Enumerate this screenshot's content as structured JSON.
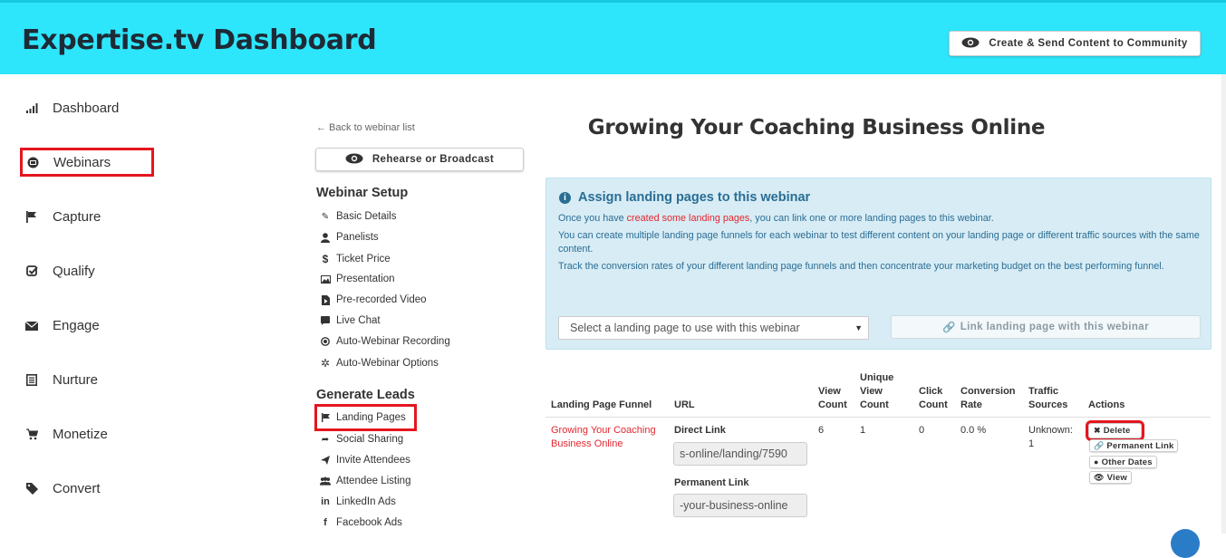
{
  "header": {
    "app_title": "Expertise.tv Dashboard",
    "create_button": "Create & Send Content to Community"
  },
  "sidebar": {
    "items": [
      {
        "label": "Dashboard",
        "icon": "bar-chart-icon"
      },
      {
        "label": "Webinars",
        "icon": "webinar-icon"
      },
      {
        "label": "Capture",
        "icon": "flag-icon"
      },
      {
        "label": "Qualify",
        "icon": "check-square-icon"
      },
      {
        "label": "Engage",
        "icon": "envelope-icon"
      },
      {
        "label": "Nurture",
        "icon": "list-icon"
      },
      {
        "label": "Monetize",
        "icon": "cart-icon"
      },
      {
        "label": "Convert",
        "icon": "tag-icon"
      }
    ]
  },
  "webinar_nav": {
    "back_link": "← Back to webinar list",
    "rehearse_button": "Rehearse or Broadcast",
    "setup_title": "Webinar Setup",
    "setup_items": [
      {
        "label": "Basic Details",
        "icon": "pencil-icon"
      },
      {
        "label": "Panelists",
        "icon": "user-icon"
      },
      {
        "label": "Ticket Price",
        "icon": "dollar-icon"
      },
      {
        "label": "Presentation",
        "icon": "image-icon"
      },
      {
        "label": "Pre-recorded Video",
        "icon": "video-file-icon"
      },
      {
        "label": "Live Chat",
        "icon": "chat-icon"
      },
      {
        "label": "Auto-Webinar Recording",
        "icon": "record-icon"
      },
      {
        "label": "Auto-Webinar Options",
        "icon": "cog-icon"
      }
    ],
    "leads_title": "Generate Leads",
    "leads_items": [
      {
        "label": "Landing Pages",
        "icon": "flag-icon"
      },
      {
        "label": "Social Sharing",
        "icon": "share-icon"
      },
      {
        "label": "Invite Attendees",
        "icon": "send-icon"
      },
      {
        "label": "Attendee Listing",
        "icon": "users-icon"
      },
      {
        "label": "LinkedIn Ads",
        "icon": "linkedin-icon"
      },
      {
        "label": "Facebook Ads",
        "icon": "facebook-icon"
      }
    ]
  },
  "main": {
    "page_title": "Growing Your Coaching Business Online",
    "info": {
      "heading": "Assign landing pages to this webinar",
      "line1_pre": "Once you have ",
      "line1_link": "created some landing pages",
      "line1_post": ", you can link one or more landing pages to this webinar.",
      "line2": "You can create multiple landing page funnels for each webinar to test different content on your landing page or different traffic sources with the same content.",
      "line3": "Track the conversion rates of your different landing page funnels and then concentrate your marketing budget on the best performing funnel.",
      "select_placeholder": "Select a landing page to use with this webinar",
      "link_button": "Link landing page with this webinar"
    },
    "table": {
      "headers": {
        "funnel": "Landing Page Funnel",
        "url": "URL",
        "view_count_1": "View",
        "view_count_2": "Count",
        "unique_1": "Unique",
        "unique_2": "View",
        "unique_3": "Count",
        "click_1": "Click",
        "click_2": "Count",
        "conv_1": "Conversion",
        "conv_2": "Rate",
        "traffic_1": "Traffic",
        "traffic_2": "Sources",
        "actions": "Actions"
      },
      "row": {
        "funnel_1": "Growing Your Coaching",
        "funnel_2": "Business Online",
        "direct_link_label": "Direct Link",
        "direct_link_value": "s-online/landing/7590",
        "permanent_link_label": "Permanent Link",
        "permanent_link_value": "-your-business-online",
        "view_count": "6",
        "unique_view_count": "1",
        "click_count": "0",
        "conversion_rate": "0.0 %",
        "traffic_1": "Unknown:",
        "traffic_2": "1",
        "actions": {
          "delete": "Delete",
          "permanent_link": "Permanent Link",
          "other_dates": "Other Dates",
          "view": "View"
        }
      }
    }
  },
  "colors": {
    "header_bg": "#2ee6fb",
    "accent_red": "#e4262f",
    "info_text": "#2a6d94",
    "info_bg": "#d7ecf5"
  }
}
